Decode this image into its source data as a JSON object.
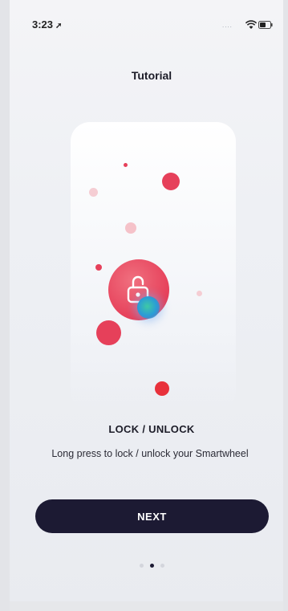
{
  "status_bar": {
    "time": "3:23",
    "location_icon": "location-arrow-icon",
    "signal": "....",
    "wifi_icon": "wifi-icon",
    "battery_icon": "battery-icon"
  },
  "header": {
    "title": "Tutorial"
  },
  "illustration": {
    "icon": "padlock-open-icon",
    "accent_color": "#e6405a",
    "touch_color": "#2a9ad8"
  },
  "content": {
    "heading": "LOCK / UNLOCK",
    "description": "Long press to lock / unlock your Smartwheel"
  },
  "actions": {
    "next_label": "NEXT"
  },
  "pager": {
    "count": 3,
    "active_index": 1
  },
  "colors": {
    "primary_dark": "#1c1a33",
    "background": "#eef0f4",
    "red": "#e6405a",
    "pink_light": "#f5cdd3"
  }
}
